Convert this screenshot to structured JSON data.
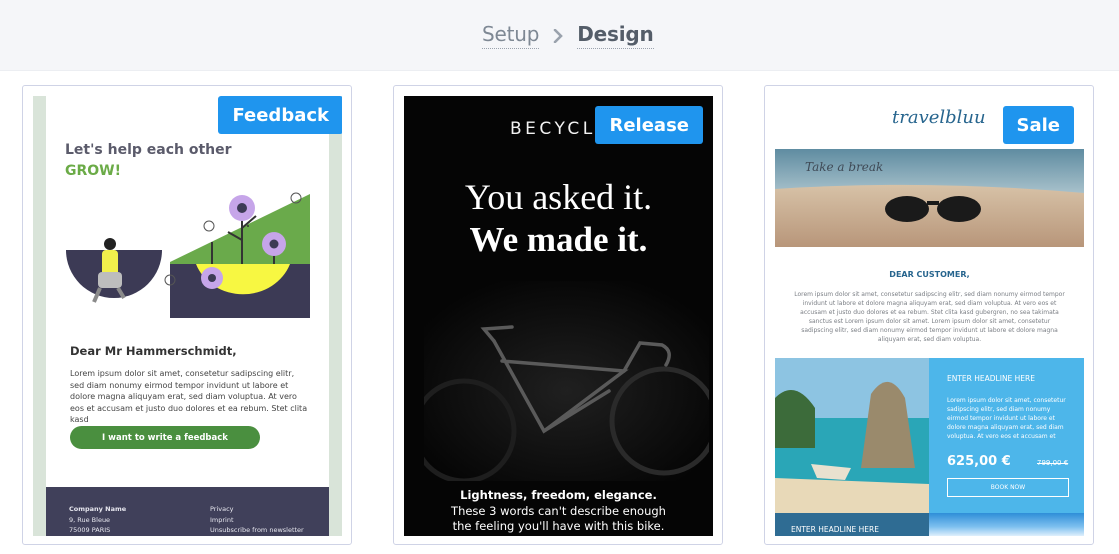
{
  "breadcrumb": {
    "setup": "Setup",
    "design": "Design"
  },
  "cards": [
    {
      "badge": "Feedback",
      "heading_line1": "Let's help each other",
      "heading_line2": "GROW!",
      "greeting": "Dear Mr Hammerschmidt,",
      "body": "Lorem ipsum dolor sit amet, consetetur sadipscing elitr, sed diam nonumy eirmod tempor invidunt ut labore et dolore magna aliquyam erat, sed diam voluptua. At vero eos et accusam et justo duo dolores et ea rebum. Stet clita kasd",
      "cta": "I want to write a feedback",
      "footer": {
        "company": "Company Name",
        "street": "9, Rue Bleue",
        "city": "75009 PARIS",
        "links": [
          "Privacy",
          "Imprint",
          "Unsubscribe from newsletter"
        ]
      }
    },
    {
      "badge": "Release",
      "brand": "BECYCLE",
      "headline1": "You asked it.",
      "headline2": "We made it.",
      "tagline": "Lightness, freedom, elegance.",
      "text1": "These 3 words can't describe enough",
      "text2": "the feeling you'll have with this bike."
    },
    {
      "badge": "Sale",
      "logo": "travelbluu",
      "hero_text": "Take a break",
      "greeting": "DEAR CUSTOMER,",
      "body": "Lorem ipsum dolor sit amet, consetetur sadipscing elitr, sed diam nonumy eirmod tempor invidunt ut labore et dolore magna aliquyam erat, sed diam voluptua. At vero eos et accusam et justo duo dolores et ea rebum. Stet clita kasd gubergren, no sea takimata sanctus est Lorem ipsum dolor sit amet. Lorem ipsum dolor sit amet, consetetur sadipscing elitr, sed diam nonumy eirmod tempor invidunt ut labore et dolore magna aliquyam erat, sed diam voluptua.",
      "offer_heading": "ENTER HEADLINE HERE",
      "offer_body": "Lorem ipsum dolor sit amet, consetetur sadipscing elitr, sed diam nonumy eirmod tempor invidunt ut labore et dolore magna aliquyam erat, sed diam voluptua. At vero eos et accusam et",
      "price": "625,00 €",
      "old_price": "799,00 €",
      "book_label": "BOOK NOW",
      "band_heading": "ENTER HEADLINE HERE"
    }
  ],
  "colors": {
    "badge": "#1f95ee",
    "feedback_green": "#6bab47",
    "offer_blue": "#4db6ea",
    "footer_dark": "#40405a"
  }
}
